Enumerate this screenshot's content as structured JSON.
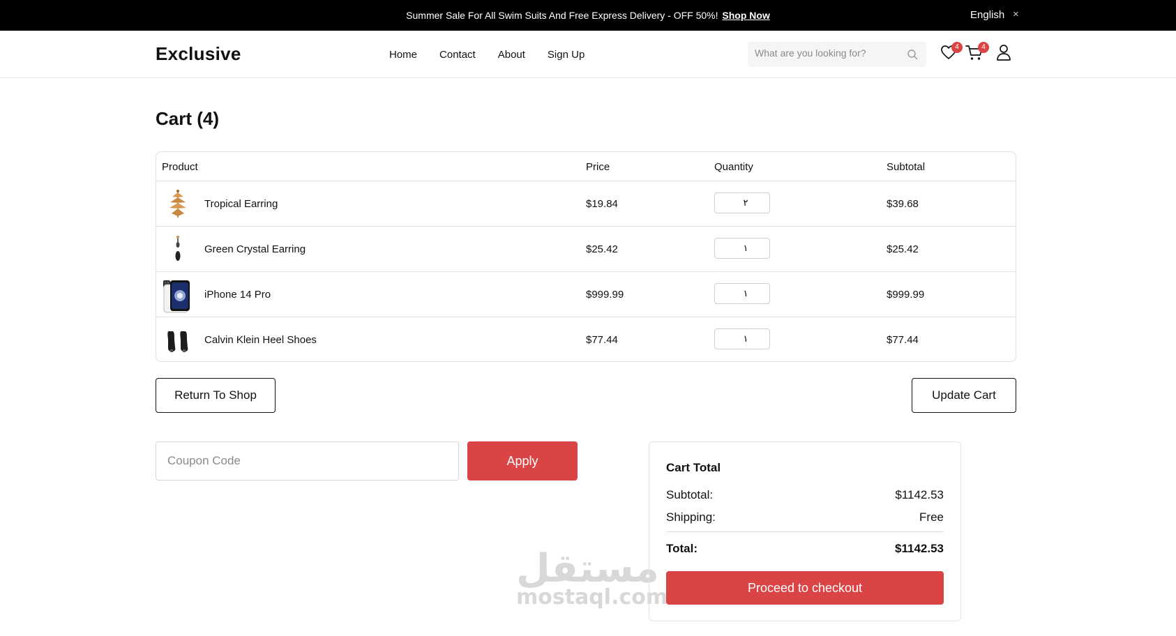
{
  "topbar": {
    "promo_text": "Summer Sale For All Swim Suits And Free Express Delivery - OFF 50%!",
    "promo_link": "Shop Now",
    "language": "English",
    "close": "×"
  },
  "header": {
    "logo": "Exclusive",
    "nav": [
      "Home",
      "Contact",
      "About",
      "Sign Up"
    ],
    "search_placeholder": "What are you looking for?",
    "wishlist_count": "4",
    "cart_count": "4"
  },
  "page": {
    "title": "Cart (4)"
  },
  "cart": {
    "headers": {
      "product": "Product",
      "price": "Price",
      "quantity": "Quantity",
      "subtotal": "Subtotal"
    },
    "items": [
      {
        "name": "Tropical Earring",
        "price": "$19.84",
        "qty": "٢",
        "subtotal": "$39.68",
        "thumb": "tropical-earring-image"
      },
      {
        "name": "Green Crystal Earring",
        "price": "$25.42",
        "qty": "١",
        "subtotal": "$25.42",
        "thumb": "crystal-earring-image"
      },
      {
        "name": "iPhone 14 Pro",
        "price": "$999.99",
        "qty": "١",
        "subtotal": "$999.99",
        "thumb": "iphone-image"
      },
      {
        "name": "Calvin Klein Heel Shoes",
        "price": "$77.44",
        "qty": "١",
        "subtotal": "$77.44",
        "thumb": "heel-shoes-image"
      }
    ]
  },
  "actions": {
    "return_label": "Return To Shop",
    "update_label": "Update Cart",
    "coupon_placeholder": "Coupon Code",
    "apply_label": "Apply"
  },
  "totals": {
    "title": "Cart Total",
    "subtotal_label": "Subtotal:",
    "subtotal_value": "$1142.53",
    "shipping_label": "Shipping:",
    "shipping_value": "Free",
    "total_label": "Total:",
    "total_value": "$1142.53",
    "checkout_label": "Proceed to checkout"
  },
  "watermark": {
    "arabic": "مستقل",
    "latin": "mostaql.com"
  },
  "colors": {
    "accent": "#db4444",
    "topbar_bg": "#000000"
  }
}
